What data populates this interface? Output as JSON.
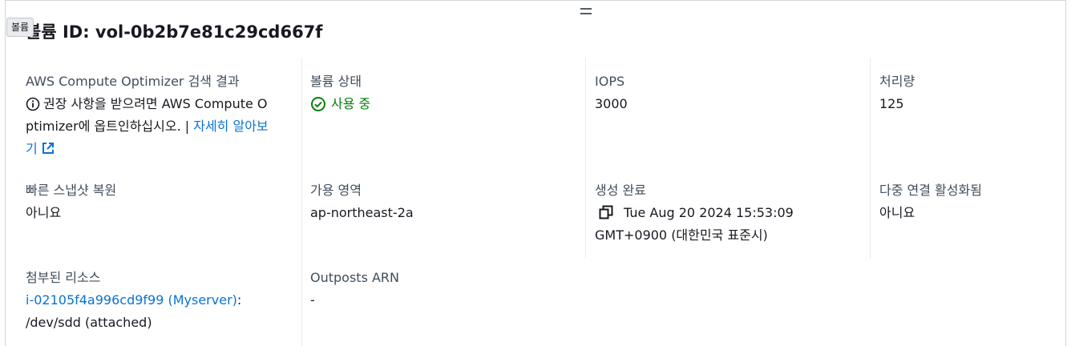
{
  "tooltip": "볼륨",
  "title": "볼륨 ID: vol-0b2b7e81c29cd667f",
  "optimizer": {
    "label": "AWS Compute Optimizer 검색 결과",
    "line1": "권장 사항을 받으려면 AWS Compute O",
    "line2": "ptimizer에 옵트인하십시오. | ",
    "link_part1": "자세히 알아보",
    "link_part2": "기"
  },
  "volume_state": {
    "label": "볼륨 상태",
    "value": "사용 중"
  },
  "iops": {
    "label": "IOPS",
    "value": "3000"
  },
  "throughput": {
    "label": "처리량",
    "value": "125"
  },
  "fast_snapshot": {
    "label": "빠른 스냅샷 복원",
    "value": "아니요"
  },
  "availability_zone": {
    "label": "가용 영역",
    "value": "ap-northeast-2a"
  },
  "created": {
    "label": "생성 완료",
    "line1": "Tue Aug 20 2024 15:53:09",
    "line2": "GMT+0900 (대한민국 표준시)"
  },
  "multi_attach": {
    "label": "다중 연결 활성화됨",
    "value": "아니요"
  },
  "attached_resources": {
    "label": "첨부된 리소스",
    "link": "i-02105f4a996cd9f99 (Myserver)",
    "suffix": ":",
    "line2": "/dev/sdd (attached)"
  },
  "outposts": {
    "label": "Outposts ARN",
    "value": "-"
  },
  "colors": {
    "link": "#0972d3",
    "success": "#037f0c",
    "label": "#414d5c",
    "text": "#16191f"
  },
  "icons": [
    "info-icon",
    "check-circle-icon",
    "external-link-icon",
    "copy-icon",
    "drag-handle-icon"
  ]
}
